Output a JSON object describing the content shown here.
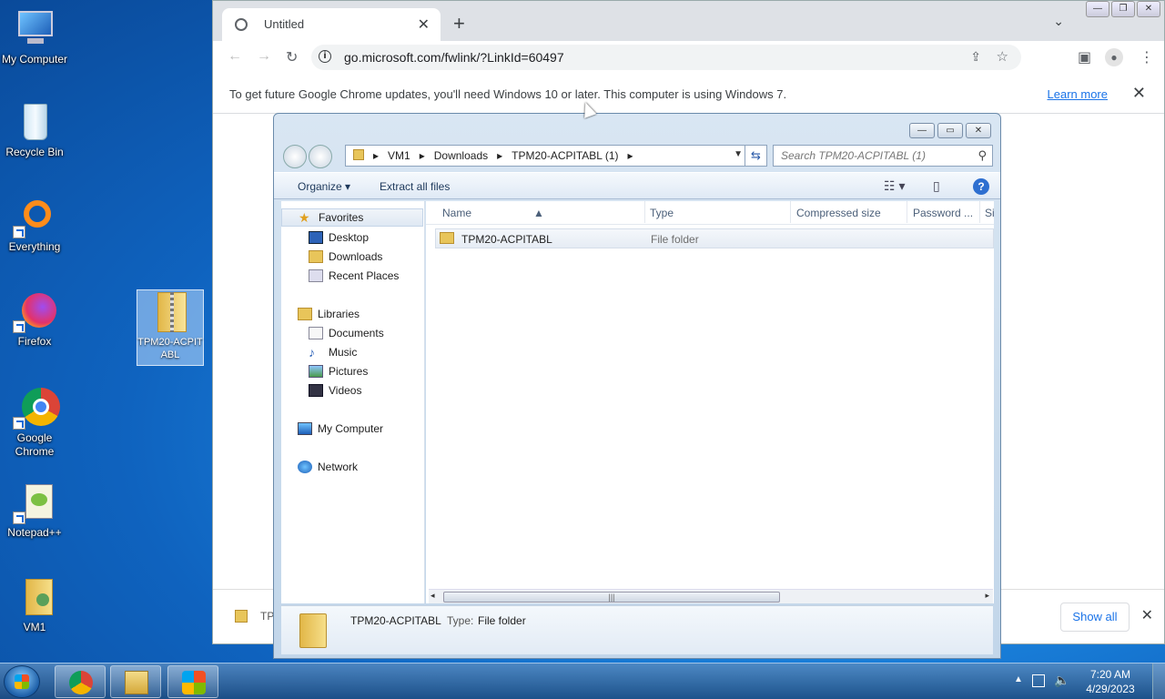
{
  "desktop": {
    "icons": [
      {
        "label": "My Computer"
      },
      {
        "label": "Recycle Bin"
      },
      {
        "label": "Everything"
      },
      {
        "label": "Firefox"
      },
      {
        "label": "Google Chrome"
      },
      {
        "label": "Notepad++"
      },
      {
        "label": "VM1"
      },
      {
        "label": "TPM20-ACPITABL"
      }
    ]
  },
  "chrome": {
    "tab_title": "Untitled",
    "url": "go.microsoft.com/fwlink/?LinkId=60497",
    "infobar_message": "To get future Google Chrome updates, you'll need Windows 10 or later. This computer is using Windows 7.",
    "learn_more": "Learn more",
    "download_item": "TP",
    "show_all": "Show all"
  },
  "explorer": {
    "breadcrumbs": [
      "VM1",
      "Downloads",
      "TPM20-ACPITABL (1)"
    ],
    "search_placeholder": "Search TPM20-ACPITABL (1)",
    "organize": "Organize",
    "extract_all": "Extract all files",
    "nav": {
      "favorites": "Favorites",
      "desktop": "Desktop",
      "downloads": "Downloads",
      "recent": "Recent Places",
      "libraries": "Libraries",
      "documents": "Documents",
      "music": "Music",
      "pictures": "Pictures",
      "videos": "Videos",
      "computer": "My Computer",
      "network": "Network"
    },
    "columns": [
      "Name",
      "Type",
      "Compressed size",
      "Password ...",
      "Si"
    ],
    "rows": [
      {
        "name": "TPM20-ACPITABL",
        "type": "File folder"
      }
    ],
    "details": {
      "name": "TPM20-ACPITABL",
      "type_label": "Type:",
      "type_value": "File folder"
    }
  },
  "taskbar": {
    "time": "7:20 AM",
    "date": "4/29/2023"
  }
}
